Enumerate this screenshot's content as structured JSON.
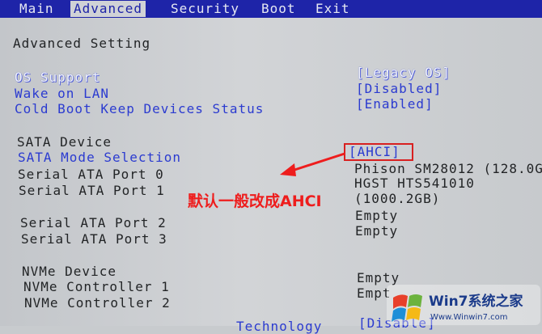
{
  "tabs": [
    {
      "label": "Main"
    },
    {
      "label": "Advanced",
      "active": true
    },
    {
      "label": "Security"
    },
    {
      "label": "Boot"
    },
    {
      "label": "Exit"
    }
  ],
  "section_title": "Advanced Setting",
  "rows": {
    "os_support": {
      "label": "OS Support",
      "value": "[Legacy OS]"
    },
    "wake_on_lan": {
      "label": "Wake on LAN",
      "value": "[Disabled]"
    },
    "cold_boot": {
      "label": "Cold Boot Keep Devices Status",
      "value": "[Enabled]"
    }
  },
  "sata": {
    "heading": "SATA Device",
    "mode_label": "SATA Mode Selection",
    "mode_value": "[AHCI]",
    "port0_label": "Serial ATA Port 0",
    "port0_value": "Phison SM28012 (128.0G",
    "port1_label": "Serial ATA Port 1",
    "port1_value_line1": "HGST HTS541010",
    "port1_value_line2": "(1000.2GB)",
    "port2_label": "Serial ATA Port 2",
    "port2_value": "Empty",
    "port3_label": "Serial ATA Port 3",
    "port3_value": "Empty"
  },
  "nvme": {
    "heading": "NVMe Device",
    "ctrl1_label": "NVMe Controller 1",
    "ctrl1_value": "Empty",
    "ctrl2_label": "NVMe Controller 2",
    "ctrl2_value": "Empt"
  },
  "cut_off_row": {
    "label": "Technology",
    "value": "[Disable]"
  },
  "annotation": "默认一般改成AHCI",
  "watermark": {
    "brand": "Win7系统之家",
    "url": "Www.Winwin7.com"
  },
  "colors": {
    "menu_bar": "#1e24a8",
    "highlight_box": "#d82020",
    "annotation": "#ee1d1d",
    "option_blue": "#2b3bd0"
  }
}
